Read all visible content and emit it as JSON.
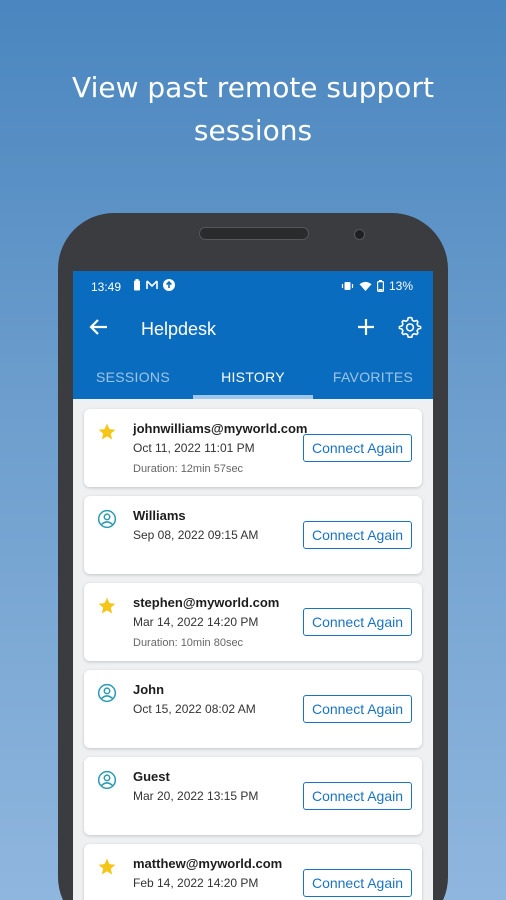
{
  "headline": {
    "line1": "View past remote support",
    "line2": "sessions"
  },
  "status_bar": {
    "time": "13:49",
    "left_icons": [
      "battery-saver-icon",
      "gmail-icon",
      "upload-icon"
    ],
    "right_icons": [
      "vibrate-icon",
      "wifi-icon",
      "battery-icon"
    ],
    "battery": "13%"
  },
  "toolbar": {
    "title": "Helpdesk",
    "back_icon": "arrow-left-icon",
    "add_icon": "plus-icon",
    "settings_icon": "gear-icon"
  },
  "tabs": [
    {
      "label": "SESSIONS",
      "active": false
    },
    {
      "label": "HISTORY",
      "active": true
    },
    {
      "label": "FAVORITES",
      "active": false
    }
  ],
  "history": [
    {
      "icon": "star-icon",
      "name": "johnwilliams@myworld.com",
      "date": "Oct 11, 2022 11:01 PM",
      "duration": "Duration: 12min 57sec",
      "button": "Connect Again"
    },
    {
      "icon": "person-icon",
      "name": "Williams",
      "date": "Sep 08, 2022 09:15 AM",
      "duration": "",
      "button": "Connect Again"
    },
    {
      "icon": "star-icon",
      "name": "stephen@myworld.com",
      "date": "Mar 14, 2022 14:20 PM",
      "duration": "Duration: 10min 80sec",
      "button": "Connect Again"
    },
    {
      "icon": "person-icon",
      "name": "John",
      "date": "Oct 15, 2022 08:02 AM",
      "duration": "",
      "button": "Connect Again"
    },
    {
      "icon": "person-icon",
      "name": "Guest",
      "date": "Mar 20, 2022 13:15 PM",
      "duration": "",
      "button": "Connect Again"
    },
    {
      "icon": "star-icon",
      "name": "matthew@myworld.com",
      "date": "Feb 14, 2022 14:20 PM",
      "duration": "",
      "button": "Connect Again"
    }
  ],
  "colors": {
    "appbar": "#0a6cbf",
    "accent": "#1a73c4",
    "star": "#f5c518",
    "person": "#2a9bb0"
  }
}
